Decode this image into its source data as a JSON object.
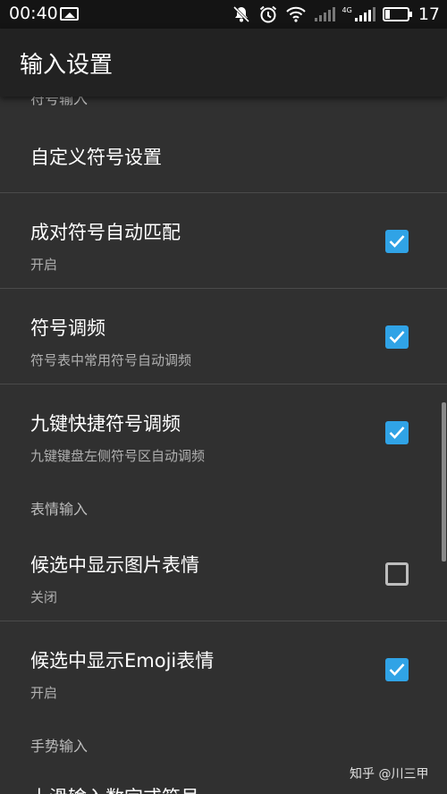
{
  "status_bar": {
    "time": "00:40",
    "network_label": "4G",
    "battery_level": "17",
    "icons": [
      "image-notification-icon",
      "bell-off-icon",
      "alarm-icon",
      "wifi-icon",
      "signal-icon",
      "signal-4g-icon",
      "battery-icon"
    ]
  },
  "app_bar": {
    "title": "输入设置"
  },
  "sections": {
    "cutoff_header": "符号输入",
    "custom_symbol": {
      "title": "自定义符号设置"
    },
    "pair_match": {
      "title": "成对符号自动匹配",
      "summary": "开启",
      "checked": true
    },
    "symbol_freq": {
      "title": "符号调频",
      "summary": "符号表中常用符号自动调频",
      "checked": true
    },
    "nine_key": {
      "title": "九键快捷符号调频",
      "summary": "九键键盘左侧符号区自动调频",
      "checked": true
    },
    "emoji_category": "表情输入",
    "candidate_image": {
      "title": "候选中显示图片表情",
      "summary": "关闭",
      "checked": false
    },
    "candidate_emoji": {
      "title": "候选中显示Emoji表情",
      "summary": "开启",
      "checked": true
    },
    "gesture_category": "手势输入",
    "gesture_first_item": "上滑输入数字或符号"
  },
  "watermark": "知乎 @川三甲",
  "colors": {
    "accent": "#30a3e6",
    "background": "#303030",
    "appbar": "#222222"
  }
}
